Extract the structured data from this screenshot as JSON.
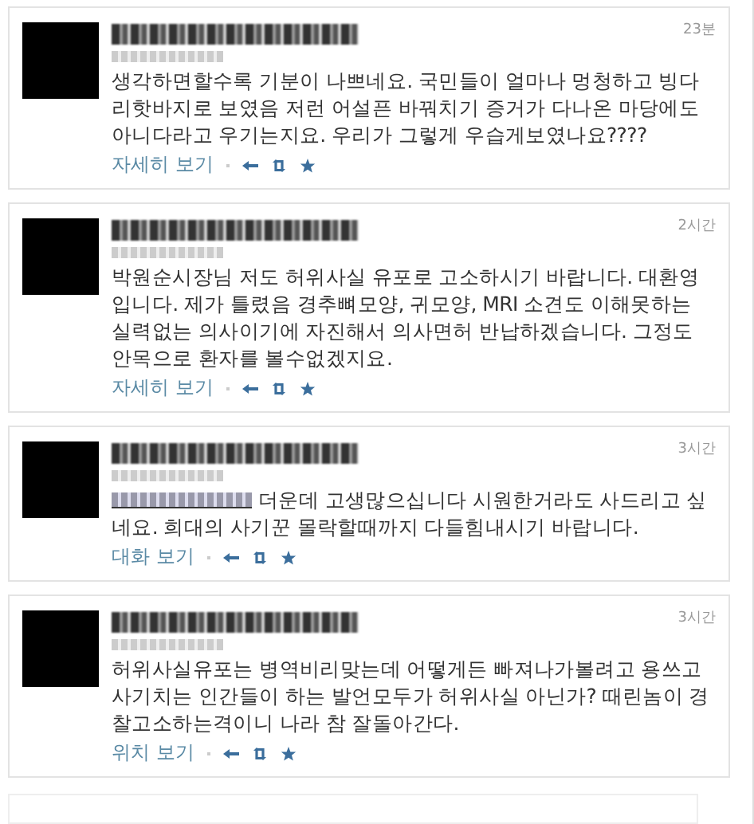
{
  "tweets": [
    {
      "time": "23분",
      "text": "생각하면할수록 기분이 나쁘네요. 국민들이 얼마나 멍청하고 빙다리핫바지로 보였음 저런 어설픈 바꿔치기 증거가 다나온 마당에도 아니다라고 우기는지요. 우리가 그렇게 우습게보였나요????",
      "has_mention": false,
      "link": "자세히 보기"
    },
    {
      "time": "2시간",
      "text": "박원순시장님 저도 허위사실 유포로 고소하시기 바랍니다. 대환영입니다. 제가 틀렸음 경추뼈모양, 귀모양, MRI 소견도 이해못하는 실력없는 의사이기에 자진해서 의사면허 반납하겠습니다. 그정도 안목으로 환자를 볼수없겠지요.",
      "has_mention": false,
      "link": "자세히 보기"
    },
    {
      "time": "3시간",
      "text": "더운데 고생많으십니다 시원한거라도 사드리고 싶네요. 희대의 사기꾼 몰락할때까지 다들힘내시기 바랍니다.",
      "has_mention": true,
      "link": "대화 보기"
    },
    {
      "time": "3시간",
      "text": "허위사실유포는 병역비리맞는데 어떻게든 빠져나가볼려고 용쓰고 사기치는 인간들이 하는 발언모두가 허위사실 아닌가? 때린놈이 경찰고소하는격이니 나라 참 잘돌아간다.",
      "has_mention": false,
      "link": "위치 보기"
    }
  ]
}
